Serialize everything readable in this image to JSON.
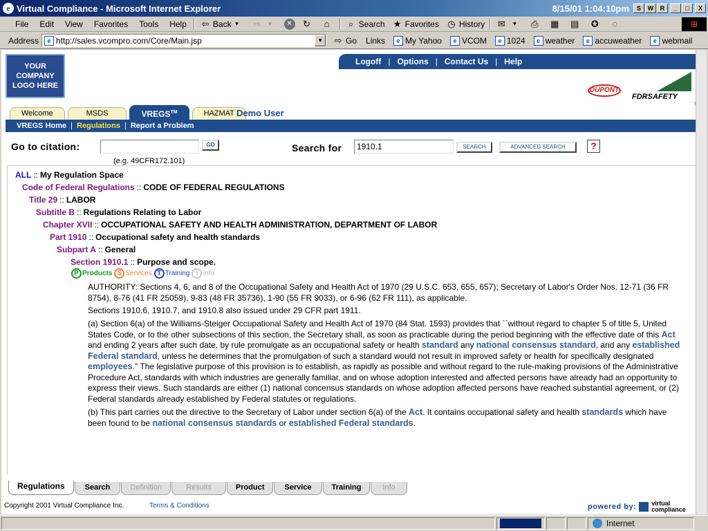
{
  "window": {
    "title": "Virtual Compliance - Microsoft Internet Explorer",
    "clock": "8/15/01  1:04:10pm",
    "buttons": [
      "S",
      "W",
      "R",
      "_",
      "□",
      "X"
    ]
  },
  "menubar": {
    "items": [
      "File",
      "Edit",
      "View",
      "Favorites",
      "Tools",
      "Help"
    ],
    "back": "Back",
    "search": "Search",
    "favorites": "Favorites",
    "history": "History"
  },
  "addressbar": {
    "label": "Address",
    "url": "http://sales.vcompro.com/Core/Main.jsp",
    "go": "Go",
    "links_label": "Links",
    "links": [
      "My Yahoo",
      "VCOM",
      "1024",
      "weather",
      "accuweather",
      "webmail"
    ]
  },
  "header": {
    "logo_lines": [
      "YOUR",
      "COMPANY",
      "LOGO HERE"
    ],
    "topnav": [
      "Logoff",
      "Options",
      "Contact Us",
      "Help"
    ],
    "dupont": "DUPONT",
    "fdr": "FDRSAFETY",
    "fdr_sm": "SM"
  },
  "tabs": {
    "items": [
      "Welcome",
      "MSDS",
      "VREGS",
      "HAZMAT"
    ],
    "vregs_tm": "TM",
    "user": "Demo User"
  },
  "subnav": [
    "VREGS Home",
    "Regulations",
    "Report a Problem"
  ],
  "search": {
    "goto_label": "Go to citation:",
    "goto_value": "",
    "goto_btn": "GO",
    "goto_example": "(e.g. 49CFR172.101)",
    "search_label": "Search for",
    "search_value": "1910.1",
    "search_btn": "SEARCH",
    "advanced_btn": "ADVANCED SEARCH",
    "help": "?"
  },
  "breadcrumbs": [
    {
      "key": "ALL",
      "value": "My Regulation Space"
    },
    {
      "key": "Code of Federal Regulations",
      "value": "CODE OF FEDERAL REGULATIONS"
    },
    {
      "key": "Title 29",
      "value": "LABOR"
    },
    {
      "key": "Subtitle B",
      "value": "Regulations Relating to Labor"
    },
    {
      "key": "Chapter XVII",
      "value": "OCCUPATIONAL SAFETY AND HEALTH ADMINISTRATION, DEPARTMENT OF LABOR"
    },
    {
      "key": "Part 1910",
      "value": "Occupational safety and health standards"
    },
    {
      "key": "Subpart A",
      "value": "General"
    },
    {
      "key": "Section 1910.1",
      "value": "Purpose and scope."
    }
  ],
  "crumb_sep": "::",
  "badges": [
    {
      "letter": "P",
      "label": "Products"
    },
    {
      "letter": "S",
      "label": "Services"
    },
    {
      "letter": "T",
      "label": "Training"
    },
    {
      "letter": "I",
      "label": "Info"
    }
  ],
  "body": {
    "authority": "AUTHORITY: Sections 4, 6, and 8 of the Occupational Safety and Health Act of 1970 (29 U.S.C. 653, 655, 657); Secretary of Labor's Order Nos. 12-71 (36 FR 8754), 8-76 (41 FR 25059), 9-83 (48 FR 35736), 1-90 (55 FR 9033), or 6-96 (62 FR 111), as applicable.",
    "sections": "Sections 1910.6, 1910.7, and 1910.8 also issued under 29 CFR part 1911.",
    "a1": "(a)  Section 6(a) of the Williams-Steiger Occupational Safety and Health Act of 1970 (84 Stat. 1593) provides that ``without regard to chapter 5 of title 5, United States Code, or to the other subsections of this section, the Secretary shall, as soon as practicable during the period beginning with the effective date of this ",
    "a_term1": "Act",
    "a2": " and ending 2 years after such date, by rule promulgate as an occupational safety or health ",
    "a_term2": "standard",
    "a3": " any ",
    "a_term3": "national consensus standard",
    "a4": ", and any ",
    "a_term4": "established Federal standard",
    "a5": ", unless he determines that the promulgation of such a standard would not result in improved safety or health for specifically designated ",
    "a_term5": "employees",
    "a6": ".\" The legislative purpose of this provision is to establish, as rapidly as possible and without regard to the rule-making provisions of the Administrative Procedure Act, standards with which industries are generally familiar, and on whose adoption interested and affected persons have already had an opportunity to express their views. Such standards are either (1) national concensus standards on whose adoption affected persons have reached substantial agreement, or (2) Federal standards already established by Federal statutes or regulations.",
    "b1": "(b)  This part carries out the directive to the Secretary of Labor under section 6(a) of the ",
    "b_term1": "Act",
    "b2": ". It contains occupational safety and health ",
    "b_term2": "standards",
    "b3": " which have been found to be ",
    "b_term3": "national consensus standards",
    "b4": " or ",
    "b_term4": "established Federal standards",
    "b5": "."
  },
  "bottom_tabs": [
    "Regulations",
    "Search",
    "Definition",
    "Results",
    "Product",
    "Service",
    "Training",
    "Info"
  ],
  "footer": {
    "copyright": "Copyright 2001 Virtual Compliance Inc.",
    "terms": "Terms & Conditions",
    "powered": "powered by:",
    "vc_line1": "virtual",
    "vc_line2": "compliance"
  },
  "statusbar": {
    "zone": "Internet",
    "progress": 1.0
  }
}
